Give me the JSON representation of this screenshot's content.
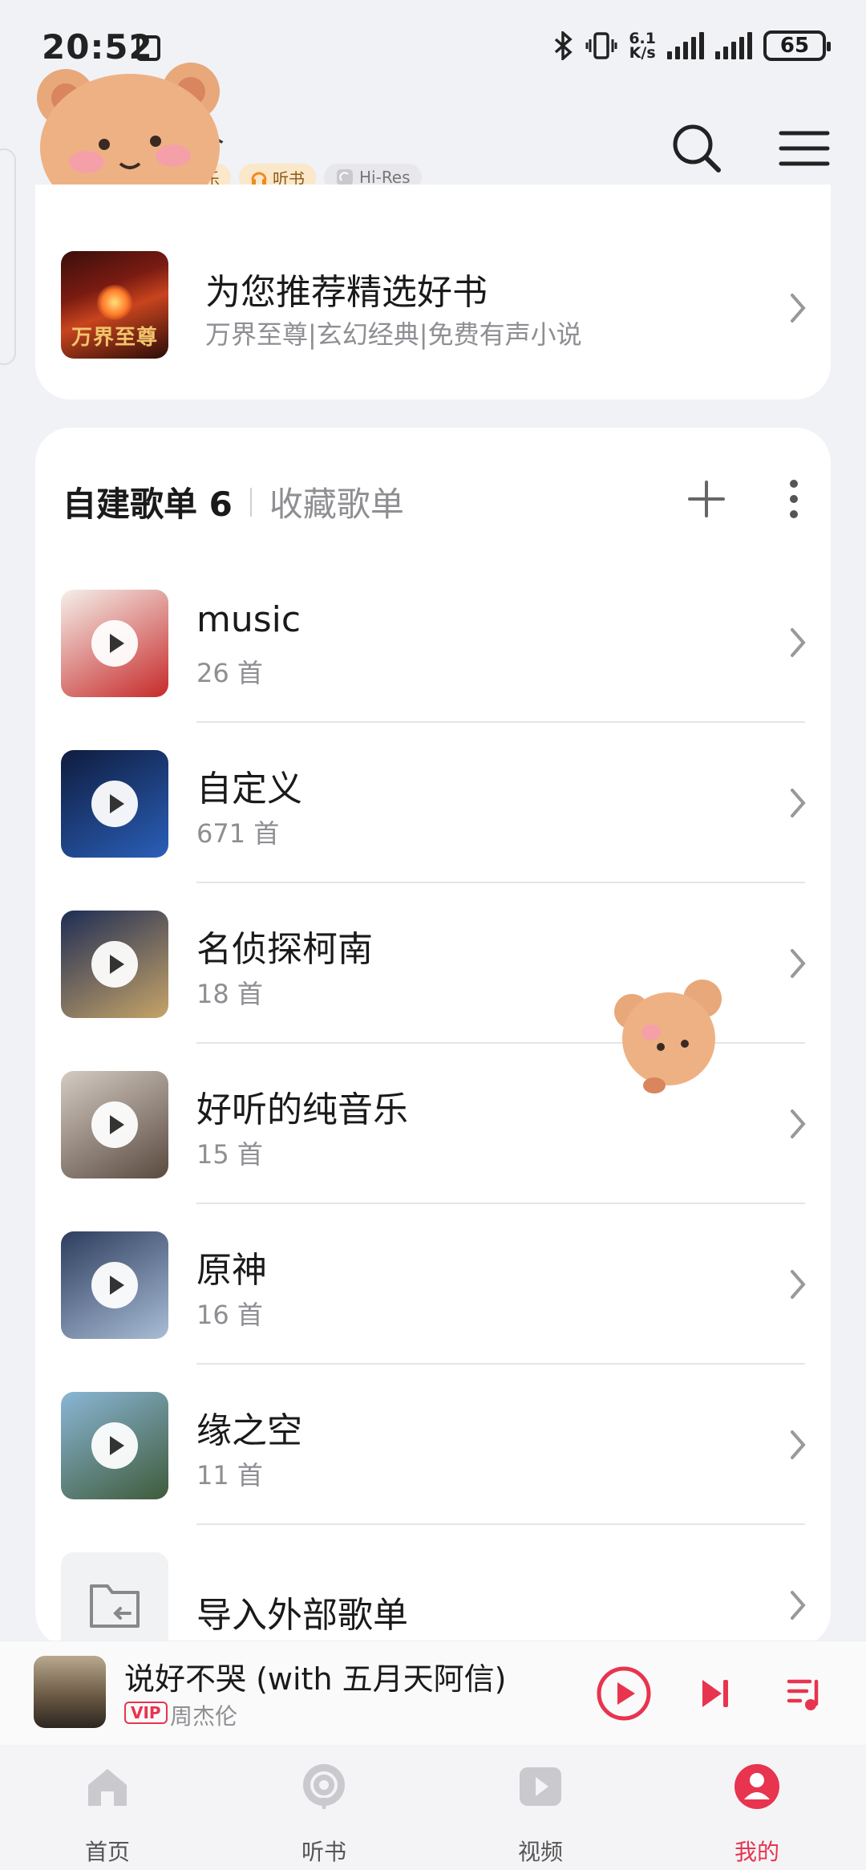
{
  "status_bar": {
    "time": "20:52",
    "net_speed_value": "6.1",
    "net_speed_unit": "K/s",
    "battery": "65"
  },
  "header": {
    "name_partial": "某人",
    "tags": [
      "乐",
      "听书",
      "Hi-Res"
    ]
  },
  "recommend": {
    "cover_title": "万界至尊",
    "title": "为您推荐精选好书",
    "subtitle": "万界至尊|玄幻经典|免费有声小说"
  },
  "playlists_section": {
    "tab_active": "自建歌单 6",
    "tab_other": "收藏歌单",
    "items": [
      {
        "name": "music",
        "count": "26 首",
        "colors": [
          "#f5f0ea",
          "#c62a2a"
        ]
      },
      {
        "name": "自定义",
        "count": "671 首",
        "colors": [
          "#0f1c3e",
          "#2a5fb8"
        ]
      },
      {
        "name": "名侦探柯南",
        "count": "18 首",
        "colors": [
          "#1e2d55",
          "#c7a468"
        ]
      },
      {
        "name": "好听的纯音乐",
        "count": "15 首",
        "colors": [
          "#d4cbc2",
          "#5a4a40"
        ]
      },
      {
        "name": "原神",
        "count": "16 首",
        "colors": [
          "#2d3d5e",
          "#a9bdd6"
        ]
      },
      {
        "name": "缘之空",
        "count": "11 首",
        "colors": [
          "#8ab6d6",
          "#3f5b3a"
        ]
      }
    ],
    "import_label": "导入外部歌单"
  },
  "player": {
    "title": "说好不哭 (with 五月天阿信)",
    "vip": "VIP",
    "artist": "周杰伦"
  },
  "nav": {
    "items": [
      "首页",
      "听书",
      "视频",
      "我的"
    ]
  },
  "colors": {
    "accent": "#e8344e",
    "background": "#f1f2f6"
  }
}
